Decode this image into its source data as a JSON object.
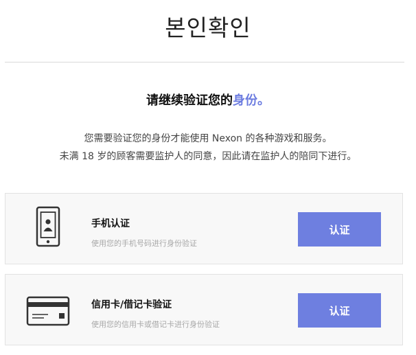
{
  "header": {
    "title": "본인확인"
  },
  "intro": {
    "headline_prefix": "请继续验证您的",
    "headline_accent": "身份。",
    "description_line1": "您需要验证您的身份才能使用 Nexon 的各种游戏和服务。",
    "description_line2": "未满 18 岁的顾客需要监护人的同意，因此请在监护人的陪同下进行。"
  },
  "methods": [
    {
      "icon": "mobile-phone-icon",
      "title": "手机认证",
      "subtitle": "使用您的手机号码进行身份验证",
      "button_label": "认证"
    },
    {
      "icon": "credit-card-icon",
      "title": "信用卡/借记卡验证",
      "subtitle": "使用您的信用卡或借记卡进行身份验证",
      "button_label": "认证"
    }
  ],
  "colors": {
    "accent": "#6c7ce0",
    "button_bg": "#6e7fe0",
    "card_bg": "#f8f8f8",
    "divider": "#d9d9d9"
  }
}
